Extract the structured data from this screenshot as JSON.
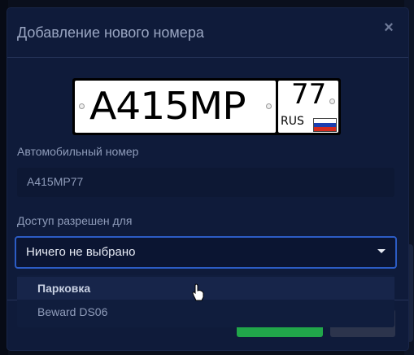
{
  "modal": {
    "title": "Добавление нового номера",
    "close_label": "×"
  },
  "plate": {
    "main_text": "А415МР",
    "region_number": "77",
    "region_code": "RUS",
    "flag_colors": [
      "#ffffff",
      "#1c3fb0",
      "#d52b1e"
    ]
  },
  "form": {
    "plate_label": "Автомобильный номер",
    "plate_value": "A415MP77",
    "access_label": "Доступ разрешен для",
    "access_selected": "Ничего не выбрано",
    "access_options": [
      "Парковка",
      "Beward DS06"
    ]
  },
  "colors": {
    "primary_button": "#21a64a",
    "secondary_button": "#2c344c",
    "focus_border": "#2c5cc5"
  }
}
